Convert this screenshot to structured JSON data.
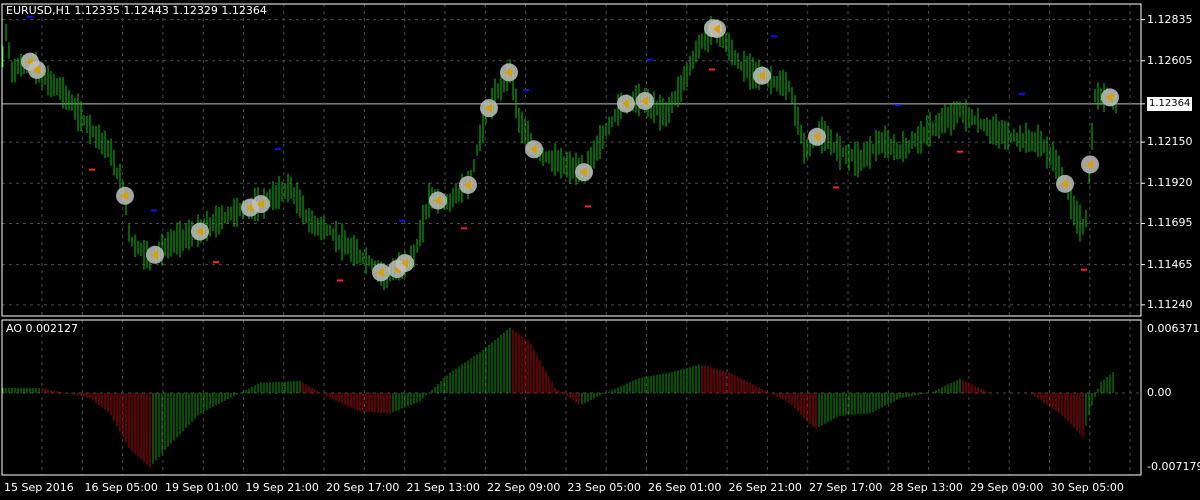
{
  "window": {
    "symbol_header": "EURUSD,H1  1.12335 1.12443 1.12329 1.12364",
    "indicator_header": "AO 0.002127"
  },
  "colors": {
    "background": "#000000",
    "grid": "#4a4a4a",
    "candle": "#00c800",
    "ao_up": "#00a000",
    "ao_down": "#c00000",
    "price_line": "#c0c0c0",
    "signal_buy": "#1010ff",
    "signal_sell": "#ff2020",
    "marker_circle": "#bfbfbf",
    "marker_arrow": "#d8a000"
  },
  "price_axis": {
    "labels": [
      "1.12835",
      "1.12605",
      "1.12364",
      "1.12150",
      "1.11920",
      "1.11695",
      "1.11465",
      "1.11240"
    ],
    "current_price": "1.12364"
  },
  "ao_axis": {
    "labels": [
      "0.006371",
      "0.00",
      "-0.007179"
    ]
  },
  "time_axis": {
    "labels": [
      "15 Sep 2016",
      "16 Sep 05:00",
      "19 Sep 01:00",
      "19 Sep 21:00",
      "20 Sep 17:00",
      "21 Sep 13:00",
      "22 Sep 09:00",
      "23 Sep 05:00",
      "26 Sep 01:00",
      "26 Sep 21:00",
      "27 Sep 17:00",
      "28 Sep 13:00",
      "29 Sep 09:00",
      "30 Sep 05:00"
    ]
  },
  "chart_data": {
    "type": "line",
    "symbol": "EURUSD",
    "timeframe": "H1",
    "ohlc_last": {
      "open": 1.12335,
      "high": 1.12443,
      "low": 1.12329,
      "close": 1.12364
    },
    "ylim": [
      1.112,
      1.129
    ],
    "price_path": [
      [
        0,
        1.1235
      ],
      [
        5,
        1.128
      ],
      [
        12,
        1.1255
      ],
      [
        30,
        1.126
      ],
      [
        45,
        1.125
      ],
      [
        60,
        1.1245
      ],
      [
        80,
        1.123
      ],
      [
        110,
        1.121
      ],
      [
        125,
        1.1185
      ],
      [
        130,
        1.116
      ],
      [
        150,
        1.115
      ],
      [
        175,
        1.116
      ],
      [
        200,
        1.1165
      ],
      [
        230,
        1.1175
      ],
      [
        260,
        1.118
      ],
      [
        290,
        1.119
      ],
      [
        310,
        1.117
      ],
      [
        330,
        1.1165
      ],
      [
        350,
        1.1155
      ],
      [
        370,
        1.1148
      ],
      [
        385,
        1.114
      ],
      [
        400,
        1.1145
      ],
      [
        415,
        1.1152
      ],
      [
        430,
        1.1185
      ],
      [
        445,
        1.118
      ],
      [
        470,
        1.1192
      ],
      [
        485,
        1.123
      ],
      [
        500,
        1.1245
      ],
      [
        510,
        1.1255
      ],
      [
        520,
        1.1225
      ],
      [
        535,
        1.121
      ],
      [
        560,
        1.1203
      ],
      [
        585,
        1.1198
      ],
      [
        600,
        1.1215
      ],
      [
        620,
        1.1235
      ],
      [
        640,
        1.124
      ],
      [
        665,
        1.123
      ],
      [
        680,
        1.1245
      ],
      [
        700,
        1.127
      ],
      [
        715,
        1.128
      ],
      [
        740,
        1.1258
      ],
      [
        770,
        1.125
      ],
      [
        790,
        1.1245
      ],
      [
        805,
        1.121
      ],
      [
        820,
        1.122
      ],
      [
        840,
        1.121
      ],
      [
        860,
        1.1205
      ],
      [
        880,
        1.1215
      ],
      [
        900,
        1.121
      ],
      [
        930,
        1.1222
      ],
      [
        960,
        1.1232
      ],
      [
        990,
        1.1222
      ],
      [
        1010,
        1.1218
      ],
      [
        1040,
        1.1215
      ],
      [
        1060,
        1.12
      ],
      [
        1075,
        1.1175
      ],
      [
        1085,
        1.1165
      ],
      [
        1095,
        1.124
      ],
      [
        1110,
        1.124
      ],
      [
        1117,
        1.1236
      ]
    ],
    "ao_ylim": [
      -0.007179,
      0.006371
    ],
    "ao_path": [
      [
        0,
        0.0005
      ],
      [
        40,
        0.0005
      ],
      [
        90,
        -0.0005
      ],
      [
        110,
        -0.002
      ],
      [
        130,
        -0.0055
      ],
      [
        150,
        -0.0072
      ],
      [
        170,
        -0.005
      ],
      [
        200,
        -0.002
      ],
      [
        230,
        -0.0005
      ],
      [
        260,
        0.001
      ],
      [
        300,
        0.0012
      ],
      [
        330,
        -0.0005
      ],
      [
        360,
        -0.0018
      ],
      [
        390,
        -0.002
      ],
      [
        420,
        -0.0008
      ],
      [
        450,
        0.002
      ],
      [
        480,
        0.004
      ],
      [
        510,
        0.0064
      ],
      [
        530,
        0.005
      ],
      [
        555,
        0.0005
      ],
      [
        580,
        -0.0012
      ],
      [
        610,
        0.0002
      ],
      [
        640,
        0.0015
      ],
      [
        670,
        0.002
      ],
      [
        700,
        0.0028
      ],
      [
        730,
        0.002
      ],
      [
        760,
        0.0005
      ],
      [
        790,
        -0.001
      ],
      [
        815,
        -0.0035
      ],
      [
        840,
        -0.0022
      ],
      [
        870,
        -0.002
      ],
      [
        900,
        -0.0005
      ],
      [
        930,
        0.0
      ],
      [
        960,
        0.0014
      ],
      [
        990,
        0.0
      ],
      [
        1030,
        0.0
      ],
      [
        1060,
        -0.002
      ],
      [
        1083,
        -0.0042
      ],
      [
        1090,
        -0.0018
      ],
      [
        1100,
        0.001
      ],
      [
        1115,
        0.0022
      ]
    ]
  }
}
